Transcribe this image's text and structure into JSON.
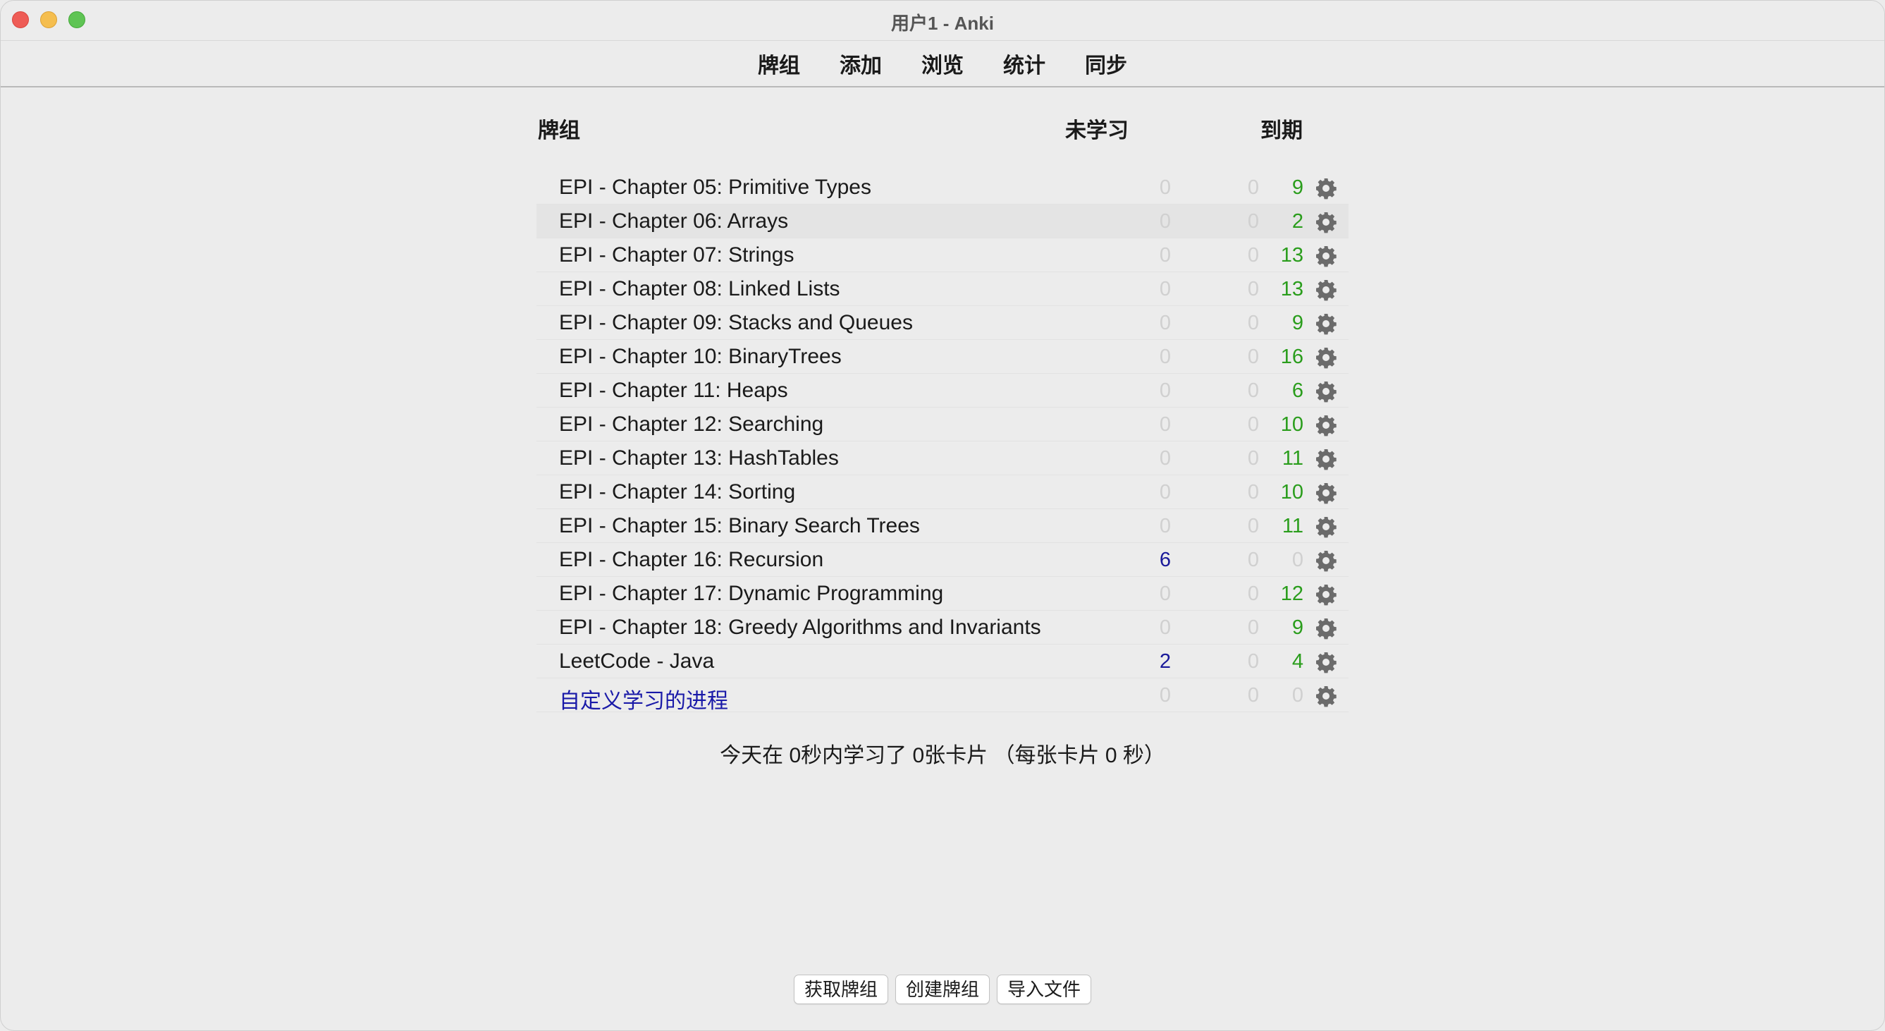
{
  "window": {
    "title": "用户1 - Anki"
  },
  "toolbar": {
    "items": [
      "牌组",
      "添加",
      "浏览",
      "统计",
      "同步"
    ]
  },
  "table": {
    "headers": {
      "deck": "牌组",
      "new": "未学习",
      "due": "到期"
    },
    "rows": [
      {
        "name": "EPI - Chapter 05: Primitive Types",
        "new": "0",
        "learn": "0",
        "due": "9"
      },
      {
        "name": "EPI - Chapter 06: Arrays",
        "new": "0",
        "learn": "0",
        "due": "2"
      },
      {
        "name": "EPI - Chapter 07: Strings",
        "new": "0",
        "learn": "0",
        "due": "13"
      },
      {
        "name": "EPI - Chapter 08: Linked Lists",
        "new": "0",
        "learn": "0",
        "due": "13"
      },
      {
        "name": "EPI - Chapter 09: Stacks and Queues",
        "new": "0",
        "learn": "0",
        "due": "9"
      },
      {
        "name": "EPI - Chapter 10: BinaryTrees",
        "new": "0",
        "learn": "0",
        "due": "16"
      },
      {
        "name": "EPI - Chapter 11: Heaps",
        "new": "0",
        "learn": "0",
        "due": "6"
      },
      {
        "name": "EPI - Chapter 12: Searching",
        "new": "0",
        "learn": "0",
        "due": "10"
      },
      {
        "name": "EPI - Chapter 13: HashTables",
        "new": "0",
        "learn": "0",
        "due": "11"
      },
      {
        "name": "EPI - Chapter 14: Sorting",
        "new": "0",
        "learn": "0",
        "due": "10"
      },
      {
        "name": "EPI - Chapter 15: Binary Search Trees",
        "new": "0",
        "learn": "0",
        "due": "11"
      },
      {
        "name": "EPI - Chapter 16: Recursion",
        "new": "6",
        "learn": "0",
        "due": "0"
      },
      {
        "name": "EPI - Chapter 17: Dynamic Programming",
        "new": "0",
        "learn": "0",
        "due": "12"
      },
      {
        "name": "EPI - Chapter 18: Greedy Algorithms and Invariants",
        "new": "0",
        "learn": "0",
        "due": "9"
      },
      {
        "name": "LeetCode - Java",
        "new": "2",
        "learn": "0",
        "due": "4"
      },
      {
        "name": "自定义学习的进程",
        "new": "0",
        "learn": "0",
        "due": "0"
      }
    ]
  },
  "summary": "今天在 0秒内学习了 0张卡片 （每张卡片 0 秒）",
  "buttons": {
    "get_decks": "获取牌组",
    "create_deck": "创建牌组",
    "import_file": "导入文件"
  },
  "colors": {
    "new_count": "#1a1a9a",
    "due_count": "#2a9d1c",
    "zero_count": "#d0d0d0",
    "custom_deck_link": "#1a1aa8"
  },
  "icons": {
    "deck_options": "gear-icon"
  }
}
